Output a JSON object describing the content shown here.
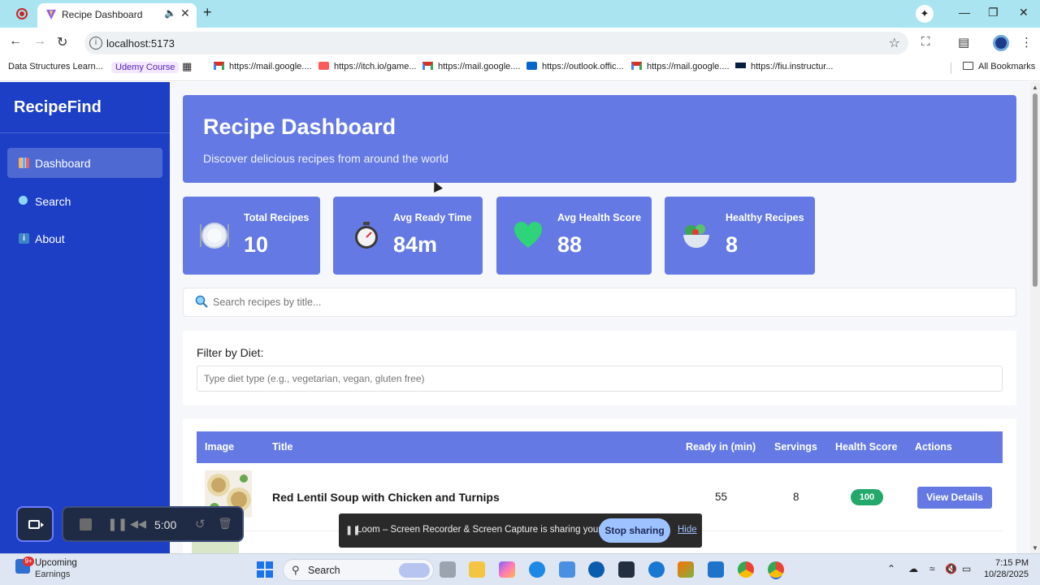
{
  "browser": {
    "tab_title": "Recipe Dashboard",
    "url": "localhost:5173",
    "bookmarks": [
      "Data Structures Learn...",
      "Udemy Course",
      "https://mail.google....",
      "https://itch.io/game...",
      "https://mail.google....",
      "https://outlook.offic...",
      "https://mail.google....",
      "https://fiu.instructur..."
    ],
    "all_bookmarks": "All Bookmarks"
  },
  "sidebar": {
    "brand": "RecipeFind",
    "items": [
      {
        "label": "Dashboard",
        "icon": "bar-chart-icon",
        "active": true
      },
      {
        "label": "Search",
        "icon": "magnifier-icon",
        "active": false
      },
      {
        "label": "About",
        "icon": "info-icon",
        "active": false
      }
    ]
  },
  "hero": {
    "title": "Recipe Dashboard",
    "subtitle": "Discover delicious recipes from around the world"
  },
  "stats": [
    {
      "label": "Total Recipes",
      "value": "10",
      "icon": "plate-icon"
    },
    {
      "label": "Avg Ready Time",
      "value": "84m",
      "icon": "stopwatch-icon"
    },
    {
      "label": "Avg Health Score",
      "value": "88",
      "icon": "heart-icon"
    },
    {
      "label": "Healthy Recipes",
      "value": "8",
      "icon": "salad-icon"
    }
  ],
  "search": {
    "placeholder": "Search recipes by title..."
  },
  "filter": {
    "label": "Filter by Diet:",
    "placeholder": "Type diet type (e.g., vegetarian, vegan, gluten free)"
  },
  "table": {
    "headers": [
      "Image",
      "Title",
      "Ready in (min)",
      "Servings",
      "Health Score",
      "Actions"
    ],
    "rows": [
      {
        "title": "Red Lentil Soup with Chicken and Turnips",
        "ready": "55",
        "servings": "8",
        "health": "100",
        "action": "View Details"
      }
    ]
  },
  "recorder": {
    "time": "5:00"
  },
  "loom": {
    "message": "Loom – Screen Recorder & Screen Capture is sharing your screen.",
    "stop": "Stop sharing",
    "hide": "Hide"
  },
  "taskbar": {
    "widget_title": "Upcoming",
    "widget_sub": "Earnings",
    "widget_badge": "9+",
    "search_label": "Search",
    "time": "7:15 PM",
    "date": "10/28/2025"
  },
  "colors": {
    "sidebar": "#1d3fc6",
    "card": "#6479e3",
    "health_badge": "#22a86b"
  }
}
